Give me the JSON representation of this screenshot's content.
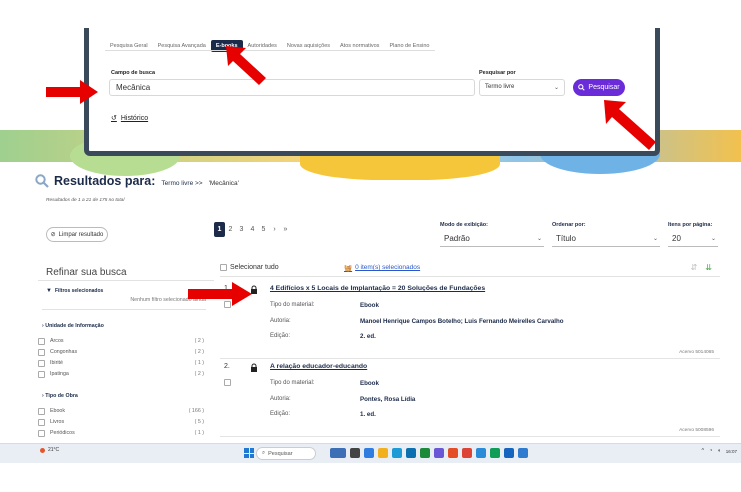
{
  "tabs": [
    "Pesquisa Geral",
    "Pesquisa Avançada",
    "E-books",
    "Autoridades",
    "Novas aquisições",
    "Atos normativos",
    "Plano de Ensino"
  ],
  "active_tab": "E-books",
  "search": {
    "field_label": "Campo de busca",
    "value": "Mecânica",
    "by_label": "Pesquisar por",
    "by_value": "Termo livre",
    "button": "Pesquisar",
    "history": "Histórico"
  },
  "results": {
    "title": "Resultados para:",
    "term_prefix": "Termo livre >>",
    "term": "'Mecânica'",
    "count_text": "Resultados de 1 a 21 de 175 no total",
    "clear_button": "Limpar resultado",
    "pages": [
      "1",
      "2",
      "3",
      "4",
      "5",
      "›",
      "»"
    ],
    "active_page": "1",
    "view_mode_label": "Modo de exibição:",
    "view_mode_value": "Padrão",
    "order_label": "Ordenar por:",
    "order_value": "Título",
    "per_page_label": "Itens por página:",
    "per_page_value": "20",
    "select_all": "Selecionar tudo",
    "selected_count": "0 item(s) selecionados"
  },
  "refine": {
    "title": "Refinar sua busca",
    "filters_title": "Filtros selecionados",
    "no_filter": "Nenhum filtro selecionado ainda",
    "unit_section": "Unidade de Informação",
    "units": [
      {
        "name": "Arcos",
        "count": "( 2 )"
      },
      {
        "name": "Congonhas",
        "count": "( 2 )"
      },
      {
        "name": "Ibirité",
        "count": "( 1 )"
      },
      {
        "name": "Ipatinga",
        "count": "( 2 )"
      }
    ],
    "type_section": "Tipo de Obra",
    "types": [
      {
        "name": "Ebook",
        "count": "( 166 )"
      },
      {
        "name": "Livros",
        "count": "( 5 )"
      },
      {
        "name": "Periódicos",
        "count": "( 1 )"
      }
    ]
  },
  "items": [
    {
      "num": "1.",
      "title": "4 Edifícios x 5 Locais de Implantação = 20 Soluções de Fundações",
      "type_label": "Tipo do material:",
      "type_value": "Ebook",
      "author_label": "Autoria:",
      "author_value": "Manoel Henrique Campos Botelho; Luis Fernando Meirelles Carvalho",
      "edition_label": "Edição:",
      "edition_value": "2. ed.",
      "acervo": "Acervo 5014065"
    },
    {
      "num": "2.",
      "title": "A relação educador-educando",
      "type_label": "Tipo do material:",
      "type_value": "Ebook",
      "author_label": "Autoria:",
      "author_value": "Pontes, Rosa Lídia",
      "edition_label": "Edição:",
      "edition_value": "1. ed.",
      "acervo": "Acervo 5008596"
    }
  ],
  "taskbar": {
    "weather": "21°C",
    "search": "Pesquisar",
    "time": "16:07"
  },
  "colors": {
    "navy": "#1c2b4a",
    "purple": "#6a2bd9",
    "arrow": "#e60000"
  }
}
